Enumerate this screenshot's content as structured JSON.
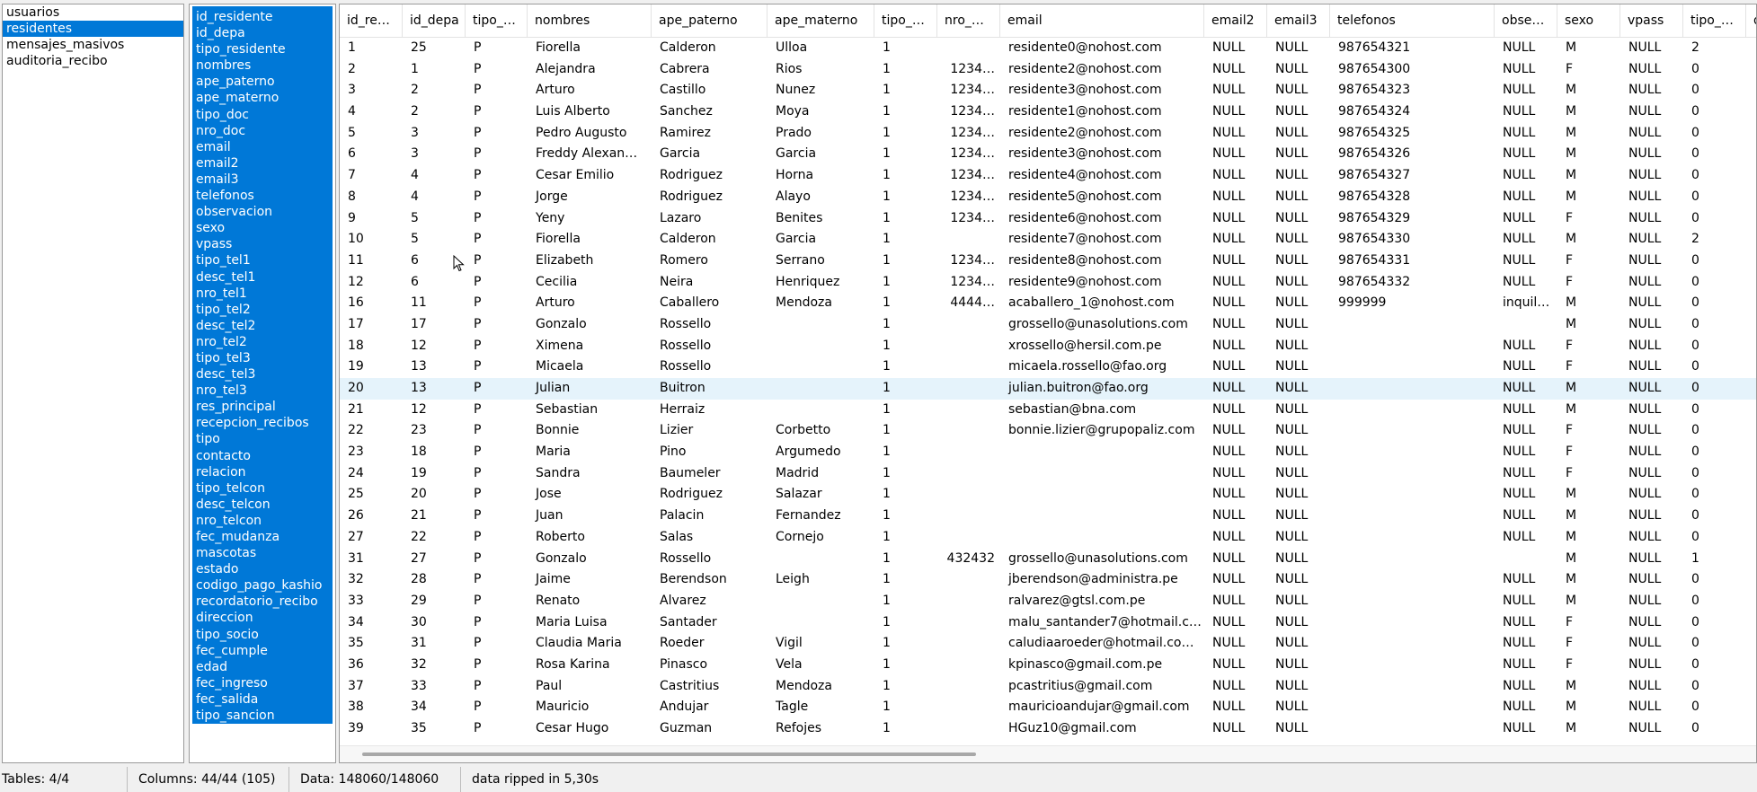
{
  "tables": {
    "items": [
      "usuarios",
      "residentes",
      "mensajes_masivos",
      "auditoria_recibo"
    ],
    "selected_index": 1
  },
  "columns": {
    "items": [
      "id_residente",
      "id_depa",
      "tipo_residente",
      "nombres",
      "ape_paterno",
      "ape_materno",
      "tipo_doc",
      "nro_doc",
      "email",
      "email2",
      "email3",
      "telefonos",
      "observacion",
      "sexo",
      "vpass",
      "tipo_tel1",
      "desc_tel1",
      "nro_tel1",
      "tipo_tel2",
      "desc_tel2",
      "nro_tel2",
      "tipo_tel3",
      "desc_tel3",
      "nro_tel3",
      "res_principal",
      "recepcion_recibos",
      "tipo",
      "contacto",
      "relacion",
      "tipo_telcon",
      "desc_telcon",
      "nro_telcon",
      "fec_mudanza",
      "mascotas",
      "estado",
      "codigo_pago_kashio",
      "recordatorio_recibo",
      "direccion",
      "tipo_socio",
      "fec_cumple",
      "edad",
      "fec_ingreso",
      "fec_salida",
      "tipo_sancion"
    ]
  },
  "grid": {
    "headers": [
      "id_re…",
      "id_depa",
      "tipo_…",
      "nombres",
      "ape_paterno",
      "ape_materno",
      "tipo_…",
      "nro_…",
      "email",
      "email2",
      "email3",
      "telefonos",
      "obse…",
      "sexo",
      "vpass",
      "tipo_…",
      "d"
    ],
    "highlighted_row": 19,
    "rows": [
      [
        "1",
        "25",
        "P",
        "Fiorella",
        "Calderon",
        "Ulloa",
        "1",
        "",
        "residente0@nohost.com",
        "NULL",
        "NULL",
        "987654321",
        "NULL",
        "M",
        "NULL",
        "2",
        ""
      ],
      [
        "2",
        "1",
        "P",
        "Alejandra",
        "Cabrera",
        "Rios",
        "1",
        "1234…",
        "residente2@nohost.com",
        "NULL",
        "NULL",
        "987654300",
        "NULL",
        "F",
        "NULL",
        "0",
        ""
      ],
      [
        "3",
        "2",
        "P",
        "Arturo",
        "Castillo",
        "Nunez",
        "1",
        "1234…",
        "residente3@nohost.com",
        "NULL",
        "NULL",
        "987654323",
        "NULL",
        "M",
        "NULL",
        "0",
        ""
      ],
      [
        "4",
        "2",
        "P",
        "Luis Alberto",
        "Sanchez",
        "Moya",
        "1",
        "1234…",
        "residente1@nohost.com",
        "NULL",
        "NULL",
        "987654324",
        "NULL",
        "M",
        "NULL",
        "0",
        ""
      ],
      [
        "5",
        "3",
        "P",
        "Pedro Augusto",
        "Ramirez",
        "Prado",
        "1",
        "1234…",
        "residente2@nohost.com",
        "NULL",
        "NULL",
        "987654325",
        "NULL",
        "M",
        "NULL",
        "0",
        ""
      ],
      [
        "6",
        "3",
        "P",
        "Freddy Alexan…",
        "Garcia",
        "Garcia",
        "1",
        "1234…",
        "residente3@nohost.com",
        "NULL",
        "NULL",
        "987654326",
        "NULL",
        "M",
        "NULL",
        "0",
        ""
      ],
      [
        "7",
        "4",
        "P",
        "Cesar Emilio",
        "Rodriguez",
        "Horna",
        "1",
        "1234…",
        "residente4@nohost.com",
        "NULL",
        "NULL",
        "987654327",
        "NULL",
        "M",
        "NULL",
        "0",
        ""
      ],
      [
        "8",
        "4",
        "P",
        "Jorge",
        "Rodriguez",
        "Alayo",
        "1",
        "1234…",
        "residente5@nohost.com",
        "NULL",
        "NULL",
        "987654328",
        "NULL",
        "M",
        "NULL",
        "0",
        ""
      ],
      [
        "9",
        "5",
        "P",
        "Yeny",
        "Lazaro",
        "Benites",
        "1",
        "1234…",
        "residente6@nohost.com",
        "NULL",
        "NULL",
        "987654329",
        "NULL",
        "F",
        "NULL",
        "0",
        ""
      ],
      [
        "10",
        "5",
        "P",
        "Fiorella",
        "Calderon",
        "Garcia",
        "1",
        "",
        "residente7@nohost.com",
        "NULL",
        "NULL",
        "987654330",
        "NULL",
        "M",
        "NULL",
        "2",
        ""
      ],
      [
        "11",
        "6",
        "P",
        "Elizabeth",
        "Romero",
        "Serrano",
        "1",
        "1234…",
        "residente8@nohost.com",
        "NULL",
        "NULL",
        "987654331",
        "NULL",
        "F",
        "NULL",
        "0",
        ""
      ],
      [
        "12",
        "6",
        "P",
        "Cecilia",
        "Neira",
        "Henriquez",
        "1",
        "1234…",
        "residente9@nohost.com",
        "NULL",
        "NULL",
        "987654332",
        "NULL",
        "F",
        "NULL",
        "0",
        ""
      ],
      [
        "16",
        "11",
        "P",
        "Arturo",
        "Caballero",
        "Mendoza",
        "1",
        "4444…",
        "acaballero_1@nohost.com",
        "NULL",
        "NULL",
        "999999",
        "inquil…",
        "M",
        "NULL",
        "0",
        ""
      ],
      [
        "17",
        "17",
        "P",
        "Gonzalo",
        "Rossello",
        "",
        "1",
        "",
        "grossello@unasolutions.com",
        "NULL",
        "NULL",
        "",
        "",
        "M",
        "NULL",
        "0",
        ""
      ],
      [
        "18",
        "12",
        "P",
        "Ximena",
        "Rossello",
        "",
        "1",
        "",
        "xrossello@hersil.com.pe",
        "NULL",
        "NULL",
        "",
        "NULL",
        "F",
        "NULL",
        "0",
        ""
      ],
      [
        "19",
        "13",
        "P",
        "Micaela",
        "Rossello",
        "",
        "1",
        "",
        "micaela.rossello@fao.org",
        "NULL",
        "NULL",
        "",
        "NULL",
        "F",
        "NULL",
        "0",
        ""
      ],
      [
        "20",
        "13",
        "P",
        "Julian",
        "Buitron",
        "",
        "1",
        "",
        "julian.buitron@fao.org",
        "NULL",
        "NULL",
        "",
        "NULL",
        "M",
        "NULL",
        "0",
        ""
      ],
      [
        "21",
        "12",
        "P",
        "Sebastian",
        "Herraiz",
        "",
        "1",
        "",
        "sebastian@bna.com",
        "NULL",
        "NULL",
        "",
        "NULL",
        "M",
        "NULL",
        "0",
        ""
      ],
      [
        "22",
        "23",
        "P",
        "Bonnie",
        "Lizier",
        "Corbetto",
        "1",
        "",
        "bonnie.lizier@grupopaliz.com",
        "NULL",
        "NULL",
        "",
        "NULL",
        "F",
        "NULL",
        "0",
        ""
      ],
      [
        "23",
        "18",
        "P",
        "Maria",
        "Pino",
        "Argumedo",
        "1",
        "",
        "",
        "NULL",
        "NULL",
        "",
        "NULL",
        "F",
        "NULL",
        "0",
        ""
      ],
      [
        "24",
        "19",
        "P",
        "Sandra",
        "Baumeler",
        "Madrid",
        "1",
        "",
        "",
        "NULL",
        "NULL",
        "",
        "NULL",
        "F",
        "NULL",
        "0",
        ""
      ],
      [
        "25",
        "20",
        "P",
        "Jose",
        "Rodriguez",
        "Salazar",
        "1",
        "",
        "",
        "NULL",
        "NULL",
        "",
        "NULL",
        "M",
        "NULL",
        "0",
        ""
      ],
      [
        "26",
        "21",
        "P",
        "Juan",
        "Palacin",
        "Fernandez",
        "1",
        "",
        "",
        "NULL",
        "NULL",
        "",
        "NULL",
        "M",
        "NULL",
        "0",
        ""
      ],
      [
        "27",
        "22",
        "P",
        "Roberto",
        "Salas",
        "Cornejo",
        "1",
        "",
        "",
        "NULL",
        "NULL",
        "",
        "NULL",
        "M",
        "NULL",
        "0",
        ""
      ],
      [
        "31",
        "27",
        "P",
        "Gonzalo",
        "Rossello",
        "",
        "1",
        "432432",
        "grossello@unasolutions.com",
        "NULL",
        "NULL",
        "",
        "",
        "M",
        "NULL",
        "1",
        ""
      ],
      [
        "32",
        "28",
        "P",
        "Jaime",
        "Berendson",
        "Leigh",
        "1",
        "",
        "jberendson@administra.pe",
        "NULL",
        "NULL",
        "",
        "NULL",
        "M",
        "NULL",
        "0",
        ""
      ],
      [
        "33",
        "29",
        "P",
        "Renato",
        "Alvarez",
        "",
        "1",
        "",
        "ralvarez@gtsl.com.pe",
        "NULL",
        "NULL",
        "",
        "NULL",
        "M",
        "NULL",
        "0",
        ""
      ],
      [
        "34",
        "30",
        "P",
        "Maria Luisa",
        "Santader",
        "",
        "1",
        "",
        "malu_santander7@hotmail.c…",
        "NULL",
        "NULL",
        "",
        "NULL",
        "F",
        "NULL",
        "0",
        ""
      ],
      [
        "35",
        "31",
        "P",
        "Claudia Maria",
        "Roeder",
        "Vigil",
        "1",
        "",
        "caludiaaroeder@hotmail.co…",
        "NULL",
        "NULL",
        "",
        "NULL",
        "F",
        "NULL",
        "0",
        ""
      ],
      [
        "36",
        "32",
        "P",
        "Rosa Karina",
        "Pinasco",
        "Vela",
        "1",
        "",
        "kpinasco@gmail.com.pe",
        "NULL",
        "NULL",
        "",
        "NULL",
        "F",
        "NULL",
        "0",
        ""
      ],
      [
        "37",
        "33",
        "P",
        "Paul",
        "Castritius",
        "Mendoza",
        "1",
        "",
        "pcastritius@gmail.com",
        "NULL",
        "NULL",
        "",
        "NULL",
        "M",
        "NULL",
        "0",
        ""
      ],
      [
        "38",
        "34",
        "P",
        "Mauricio",
        "Andujar",
        "Tagle",
        "1",
        "",
        "mauricioandujar@gmail.com",
        "NULL",
        "NULL",
        "",
        "NULL",
        "M",
        "NULL",
        "0",
        ""
      ],
      [
        "39",
        "35",
        "P",
        "Cesar Hugo",
        "Guzman",
        "Refojes",
        "1",
        "",
        "HGuz10@gmail.com",
        "NULL",
        "NULL",
        "",
        "NULL",
        "M",
        "NULL",
        "0",
        ""
      ]
    ]
  },
  "status": {
    "tables": "Tables: 4/4",
    "columns": "Columns: 44/44 (105)",
    "data": "Data: 148060/148060",
    "message": "data ripped in 5,30s"
  },
  "colors": {
    "selection": "#0078d7",
    "row_highlight": "#e5f3fb"
  },
  "icons": {
    "cursor": "mouse-pointer-icon"
  }
}
